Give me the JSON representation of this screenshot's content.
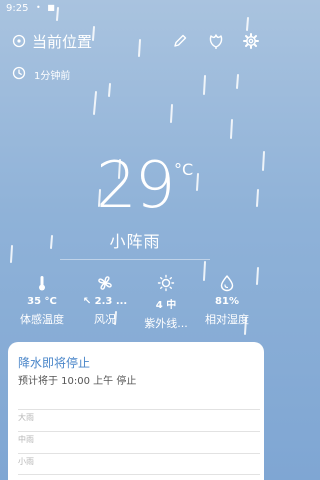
{
  "status_bar": {
    "time": "9:25",
    "indicators": "• ■"
  },
  "header": {
    "location": "当前位置",
    "icons": [
      "location-pin-icon",
      "edit-icon",
      "leaf-icon",
      "gear-icon"
    ]
  },
  "updated": {
    "text": "1分钟前",
    "icon": "clock-icon"
  },
  "current": {
    "temperature": "29",
    "unit": "°C",
    "condition": "小阵雨"
  },
  "stats": [
    {
      "icon": "thermometer-icon",
      "value": "35 °C",
      "label": "体感温度"
    },
    {
      "icon": "fan-icon",
      "value": "↖ 2.3 ...",
      "label": "风况"
    },
    {
      "icon": "sun-icon",
      "value": "4 中",
      "label": "紫外线..."
    },
    {
      "icon": "droplet-icon",
      "value": "81%",
      "label": "相对湿度"
    }
  ],
  "precip_card": {
    "title": "降水即将停止",
    "subtitle": "预计将于 10:00 上午 停止",
    "scale": [
      "大雨",
      "中雨",
      "小雨"
    ]
  },
  "colors": {
    "accent": "#4a86c9",
    "background_top": "#a9c3df",
    "background_bottom": "#7fa6d3"
  }
}
